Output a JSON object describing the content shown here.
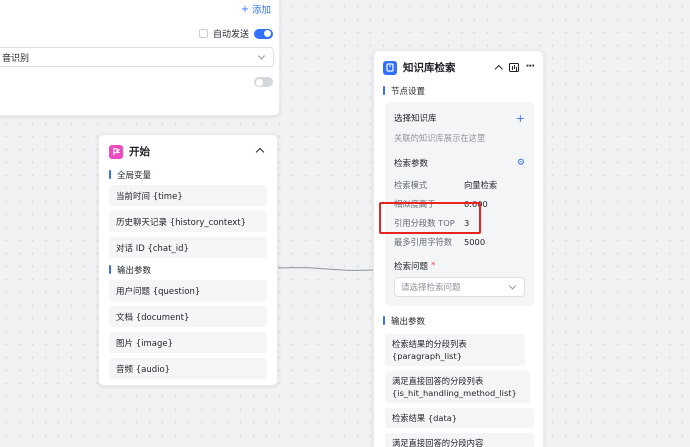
{
  "top_card": {
    "add_label": "添加",
    "auto_send_label": "自动发送",
    "select_value": "音识别"
  },
  "start_node": {
    "title": "开始",
    "icon_color": "#f04abf",
    "sections": [
      {
        "label": "全局变量",
        "fields": [
          "当前时间 {time}",
          "历史聊天记录 {history_context}",
          "对话 ID {chat_id}"
        ]
      },
      {
        "label": "输出参数",
        "fields": [
          "用户问题 {question}",
          "文档 {document}",
          "图片 {image}",
          "音频 {audio}"
        ]
      }
    ]
  },
  "kb_node": {
    "title": "知识库检索",
    "icon_color": "#3370ff",
    "node_settings_label": "节点设置",
    "select_kb_label": "选择知识库",
    "select_kb_hint": "关联的知识库展示在这里",
    "search_params_label": "检索参数",
    "params": [
      {
        "key": "检索模式",
        "value": "向量检索"
      },
      {
        "key": "相似度高于",
        "value": "0.600"
      },
      {
        "key": "引用分段数 TOP",
        "value": "3"
      },
      {
        "key": "最多引用字符数",
        "value": "5000"
      }
    ],
    "question_label": "检索问题",
    "question_required_mark": "*",
    "question_placeholder": "请选择检索问题",
    "output_label": "输出参数",
    "outputs": [
      "检索结果的分段列表 {paragraph_list}",
      "满足直接回答的分段列表 {is_hit_handling_method_list}",
      "检索结果 {data}",
      "满足直接回答的分段内容"
    ]
  },
  "colors": {
    "accent": "#3370ff",
    "highlight": "#e8241f"
  }
}
